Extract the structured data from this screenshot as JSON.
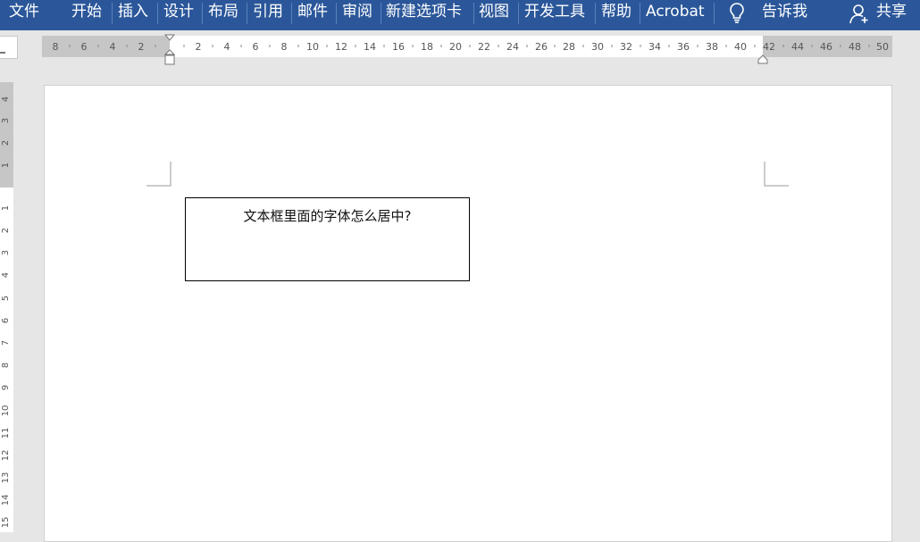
{
  "ribbon": {
    "tabs": [
      {
        "id": "file",
        "label": "文件"
      },
      {
        "id": "home",
        "label": "开始"
      },
      {
        "id": "insert",
        "label": "插入"
      },
      {
        "id": "design",
        "label": "设计"
      },
      {
        "id": "layout",
        "label": "布局"
      },
      {
        "id": "references",
        "label": "引用"
      },
      {
        "id": "mailings",
        "label": "邮件"
      },
      {
        "id": "review",
        "label": "审阅"
      },
      {
        "id": "newtab",
        "label": "新建选项卡"
      },
      {
        "id": "view",
        "label": "视图"
      },
      {
        "id": "developer",
        "label": "开发工具"
      },
      {
        "id": "help",
        "label": "帮助"
      },
      {
        "id": "acrobat",
        "label": "Acrobat"
      }
    ],
    "tell_me_label": "告诉我",
    "share_label": "共享",
    "tell_icon": "lightbulb-icon",
    "share_icon": "person-add-icon",
    "background_color": "#2b579a"
  },
  "horizontal_ruler": {
    "left_ticks": [
      "8",
      "6",
      "4",
      "2"
    ],
    "right_ticks": [
      "2",
      "4",
      "6",
      "8",
      "10",
      "12",
      "14",
      "16",
      "18",
      "20",
      "22",
      "24",
      "26",
      "28",
      "30",
      "32",
      "34",
      "36",
      "38",
      "40",
      "42",
      "44",
      "46",
      "48",
      "50"
    ]
  },
  "vertical_ruler": {
    "top_ticks": [
      "4",
      "3",
      "2",
      "1"
    ],
    "body_ticks": [
      "1",
      "2",
      "3",
      "4",
      "5",
      "6",
      "7",
      "8",
      "9",
      "10",
      "11",
      "12",
      "13",
      "14",
      "15"
    ]
  },
  "document": {
    "textbox_text": "文本框里面的字体怎么居中?"
  }
}
